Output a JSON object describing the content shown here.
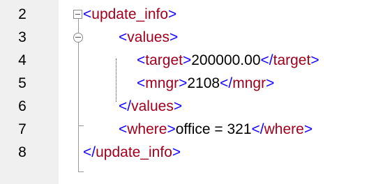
{
  "editor": {
    "line_numbers": [
      "2",
      "3",
      "4",
      "5",
      "6",
      "7",
      "8"
    ],
    "lines": [
      {
        "open": "<update_info>"
      },
      {
        "open": "<values>"
      },
      {
        "open": "<target>",
        "text": "200000.00",
        "close": "</target>"
      },
      {
        "open": "<mngr>",
        "text": "2108",
        "close": "</mngr>"
      },
      {
        "open": "</values>"
      },
      {
        "open": "<where>",
        "text": "office = 321",
        "close": "</where>"
      },
      {
        "open": "</update_info>"
      }
    ]
  },
  "colors": {
    "tag_name": "#a0001e",
    "bracket": "#1400ff",
    "text": "#000000",
    "gutter": "#f0f0f0"
  }
}
